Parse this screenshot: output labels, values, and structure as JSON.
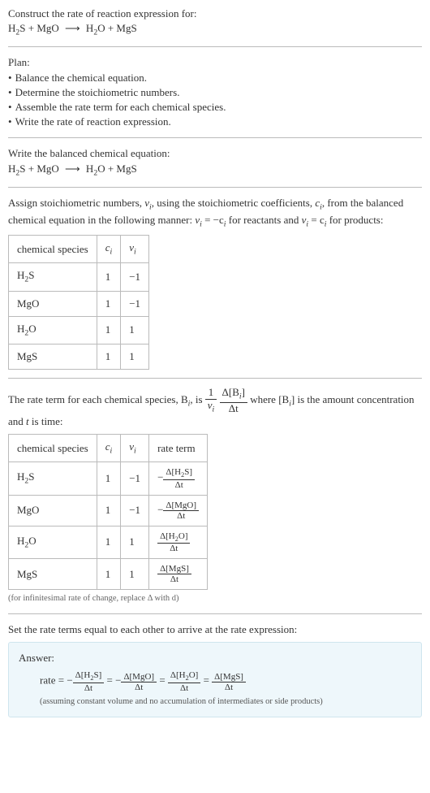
{
  "intro": {
    "line1": "Construct the rate of reaction expression for:",
    "eq_lhs1": "H",
    "eq_lhs1_sub": "2",
    "eq_lhs1b": "S + MgO",
    "arrow": "⟶",
    "eq_rhs1": "H",
    "eq_rhs1_sub": "2",
    "eq_rhs1b": "O + MgS"
  },
  "plan": {
    "heading": "Plan:",
    "items": [
      "Balance the chemical equation.",
      "Determine the stoichiometric numbers.",
      "Assemble the rate term for each chemical species.",
      "Write the rate of reaction expression."
    ],
    "bullet": "•"
  },
  "balanced": {
    "heading": "Write the balanced chemical equation:",
    "lhs1": "H",
    "lhs1_sub": "2",
    "lhs1b": "S + MgO",
    "arrow": "⟶",
    "rhs1": "H",
    "rhs1_sub": "2",
    "rhs1b": "O + MgS"
  },
  "stoich": {
    "para_a": "Assign stoichiometric numbers, ",
    "nu": "ν",
    "i": "i",
    "para_b": ", using the stoichiometric coefficients, ",
    "c": "c",
    "para_c": ", from the balanced chemical equation in the following manner: ",
    "eq1_lhs": "ν",
    "eq1_rhs": " = −c",
    "para_d": " for reactants and ",
    "eq2_lhs": "ν",
    "eq2_rhs": " = c",
    "para_e": " for products:",
    "headers": {
      "species": "chemical species",
      "ci": "c",
      "nui": "ν"
    },
    "rows": [
      {
        "sp_a": "H",
        "sp_sub": "2",
        "sp_b": "S",
        "c": "1",
        "nu": "−1"
      },
      {
        "sp_a": "MgO",
        "sp_sub": "",
        "sp_b": "",
        "c": "1",
        "nu": "−1"
      },
      {
        "sp_a": "H",
        "sp_sub": "2",
        "sp_b": "O",
        "c": "1",
        "nu": "1"
      },
      {
        "sp_a": "MgS",
        "sp_sub": "",
        "sp_b": "",
        "c": "1",
        "nu": "1"
      }
    ]
  },
  "rateterm": {
    "para_a": "The rate term for each chemical species, B",
    "para_b": ", is ",
    "frac1_num": "1",
    "frac1_den_a": "ν",
    "frac2_num_a": "Δ[B",
    "frac2_num_b": "]",
    "frac2_den": "Δt",
    "para_c": " where [B",
    "para_d": "] is the amount concentration and ",
    "t": "t",
    "para_e": " is time:",
    "headers": {
      "species": "chemical species",
      "ci": "c",
      "nui": "ν",
      "rate": "rate term"
    },
    "rows": [
      {
        "sp_a": "H",
        "sp_sub": "2",
        "sp_b": "S",
        "c": "1",
        "nu": "−1",
        "neg": "−",
        "conc_a": "Δ[H",
        "conc_sub": "2",
        "conc_b": "S]",
        "den": "Δt"
      },
      {
        "sp_a": "MgO",
        "sp_sub": "",
        "sp_b": "",
        "c": "1",
        "nu": "−1",
        "neg": "−",
        "conc_a": "Δ[MgO]",
        "conc_sub": "",
        "conc_b": "",
        "den": "Δt"
      },
      {
        "sp_a": "H",
        "sp_sub": "2",
        "sp_b": "O",
        "c": "1",
        "nu": "1",
        "neg": "",
        "conc_a": "Δ[H",
        "conc_sub": "2",
        "conc_b": "O]",
        "den": "Δt"
      },
      {
        "sp_a": "MgS",
        "sp_sub": "",
        "sp_b": "",
        "c": "1",
        "nu": "1",
        "neg": "",
        "conc_a": "Δ[MgS]",
        "conc_sub": "",
        "conc_b": "",
        "den": "Δt"
      }
    ],
    "note": "(for infinitesimal rate of change, replace Δ with d)"
  },
  "final": {
    "heading": "Set the rate terms equal to each other to arrive at the rate expression:",
    "answer_label": "Answer:",
    "rate_word": "rate = ",
    "terms": [
      {
        "neg": "−",
        "num_a": "Δ[H",
        "num_sub": "2",
        "num_b": "S]",
        "den": "Δt"
      },
      {
        "neg": "−",
        "num_a": "Δ[MgO]",
        "num_sub": "",
        "num_b": "",
        "den": "Δt"
      },
      {
        "neg": "",
        "num_a": "Δ[H",
        "num_sub": "2",
        "num_b": "O]",
        "den": "Δt"
      },
      {
        "neg": "",
        "num_a": "Δ[MgS]",
        "num_sub": "",
        "num_b": "",
        "den": "Δt"
      }
    ],
    "eq": " = ",
    "note": "(assuming constant volume and no accumulation of intermediates or side products)"
  }
}
